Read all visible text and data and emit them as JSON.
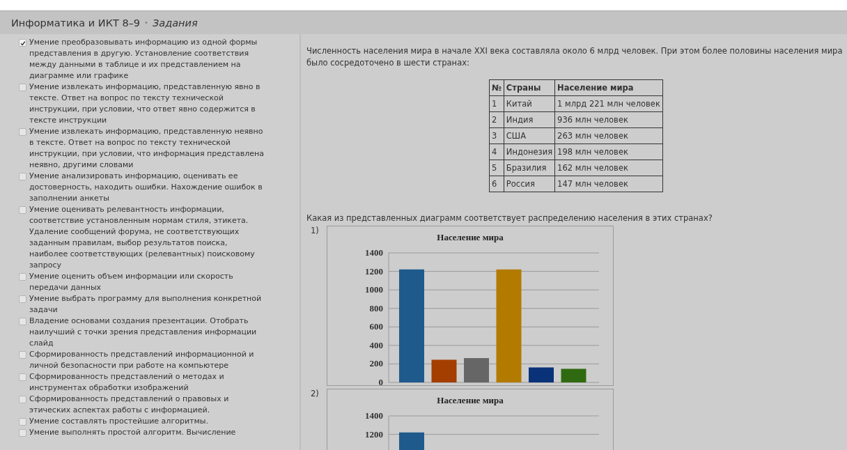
{
  "header": {
    "course": "Информатика и ИКТ 8–9",
    "separator": "•",
    "section": "Задания"
  },
  "skills": [
    {
      "label": "Умение преобразовывать информацию из одной формы представления в другую. Установление соответствия между данными в таблице и их представлением на диаграмме или графике",
      "checked": true
    },
    {
      "label": "Умение извлекать информацию, представленную явно в тексте. Ответ на вопрос по тексту технической инструкции, при условии, что ответ явно содержится в тексте инструкции",
      "checked": false
    },
    {
      "label": "Умение извлекать информацию, представленную неявно в тексте. Ответ на вопрос по тексту технической инструкции, при условии, что информация представлена неявно, другими словами",
      "checked": false
    },
    {
      "label": "Умение анализировать информацию, оценивать ее достоверность, находить ошибки. Нахождение ошибок в заполнении анкеты",
      "checked": false
    },
    {
      "label": "Умение оценивать релевантность информации, соответствие установленным нормам стиля, этикета. Удаление сообщений форума, не соответствующих заданным правилам, выбор результатов поиска, наиболее соответствующих (релевантных) поисковому запросу",
      "checked": false
    },
    {
      "label": "Умение оценить объем информации или скорость передачи данных",
      "checked": false
    },
    {
      "label": "Умение выбрать программу для выполнения конкретной задачи",
      "checked": false
    },
    {
      "label": "Владение основами создания презентации. Отобрать наилучший с точки зрения представления информации слайд",
      "checked": false
    },
    {
      "label": "Сформированность представлений информационной и личной безопасности при работе на компьютере",
      "checked": false
    },
    {
      "label": "Сформированность представлений о методах и инструментах обработки изображений",
      "checked": false
    },
    {
      "label": "Сформированность представлений о правовых и этических аспектах работы с информацией.",
      "checked": false
    },
    {
      "label": "Умение составлять простейшие алгоритмы.",
      "checked": false
    },
    {
      "label": "Умение выполнять простой алгоритм. Вычисление",
      "checked": false
    }
  ],
  "task": {
    "intro": "Численность населения мира в начале XXI века составляла около 6 млрд человек. При этом более половины населения мира было сосредоточено в шести странах:",
    "table": {
      "columns": [
        "№",
        "Страны",
        "Население мира"
      ],
      "rows": [
        [
          "1",
          "Китай",
          "1 млрд 221 млн человек"
        ],
        [
          "2",
          "Индия",
          "936 млн человек"
        ],
        [
          "3",
          "США",
          "263 млн человек"
        ],
        [
          "4",
          "Индонезия",
          "198 млн человек"
        ],
        [
          "5",
          "Бразилия",
          "162 млн человек"
        ],
        [
          "6",
          "Россия",
          "147 млн человек"
        ]
      ]
    },
    "question": "Какая из представленных диаграмм соответствует распределению населения в этих странах?",
    "options": [
      {
        "number": "1)",
        "chart_data": {
          "type": "bar",
          "grid": true,
          "title": "Население мира",
          "ylim": [
            0,
            1400
          ],
          "yticks": [
            0,
            200,
            400,
            600,
            800,
            1000,
            1200,
            1400
          ],
          "values": [
            1221,
            245,
            263,
            1221,
            162,
            147
          ],
          "colors": [
            "#1f5a8c",
            "#a33e00",
            "#666666",
            "#b37a00",
            "#0a3278",
            "#306a10"
          ]
        }
      },
      {
        "number": "2)",
        "chart_data": {
          "type": "bar",
          "grid": true,
          "title": "Население мира",
          "ylim": [
            0,
            1400
          ],
          "yticks": [
            1200,
            1400
          ],
          "values": [
            1221
          ],
          "colors": [
            "#1f5a8c"
          ]
        }
      }
    ]
  }
}
